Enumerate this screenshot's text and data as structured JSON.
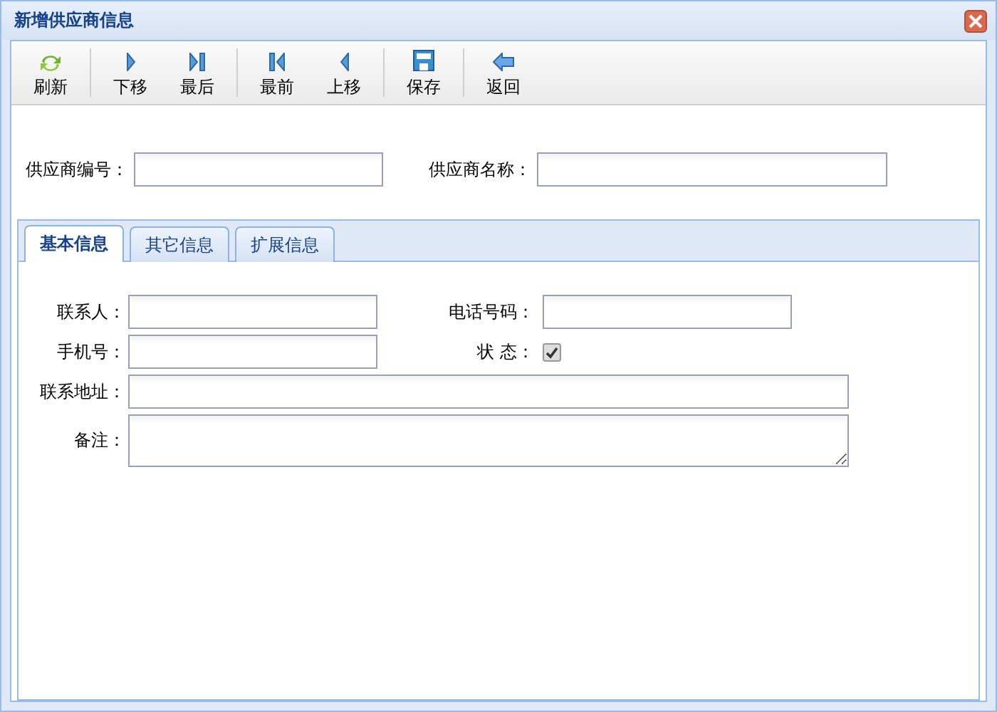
{
  "window": {
    "title": "新增供应商信息"
  },
  "toolbar": [
    {
      "label": "刷新",
      "kind": "refresh",
      "separator_after": true
    },
    {
      "label": "下移",
      "kind": "next",
      "separator_after": false
    },
    {
      "label": "最后",
      "kind": "last",
      "separator_after": true
    },
    {
      "label": "最前",
      "kind": "first",
      "separator_after": false
    },
    {
      "label": "上移",
      "kind": "prev",
      "separator_after": true
    },
    {
      "label": "保存",
      "kind": "save",
      "separator_after": true
    },
    {
      "label": "返回",
      "kind": "back",
      "separator_after": false
    }
  ],
  "header_fields": [
    {
      "label": "供应商编号："
    },
    {
      "label": "供应商名称："
    }
  ],
  "tabs": [
    {
      "label": "基本信息",
      "selected": true
    },
    {
      "label": "其它信息",
      "selected": false
    },
    {
      "label": "扩展信息",
      "selected": false
    }
  ],
  "form_rows": [
    [
      {
        "label": "联系人：",
        "kind": "text"
      },
      {
        "label": "电话号码：",
        "kind": "text"
      }
    ],
    [
      {
        "label": "手机号：",
        "kind": "text"
      },
      {
        "label": "状 态：",
        "kind": "checkbox",
        "checked": true
      }
    ],
    [
      {
        "label": "联系地址：",
        "kind": "wide"
      }
    ],
    [
      {
        "label": "备注：",
        "kind": "textarea"
      }
    ]
  ]
}
